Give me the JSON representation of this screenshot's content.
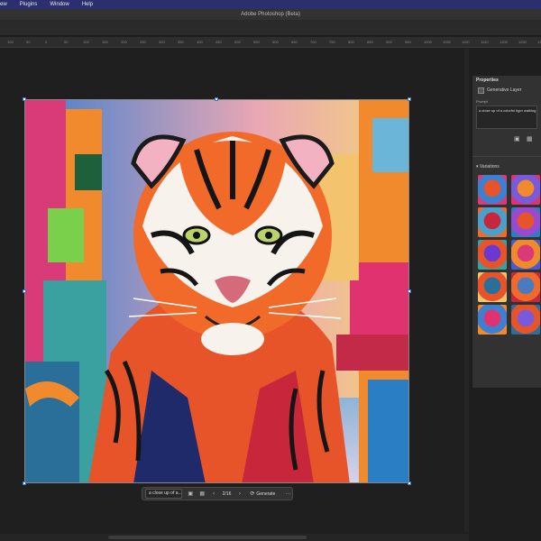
{
  "menu": {
    "items": [
      "ew",
      "Plugins",
      "Window",
      "Help"
    ]
  },
  "window": {
    "title": "Adobe Photoshop (Beta)"
  },
  "ruler": {
    "ticks": [
      "100",
      "50",
      "0",
      "50",
      "100",
      "150",
      "200",
      "250",
      "300",
      "350",
      "400",
      "450",
      "500",
      "550",
      "600",
      "650",
      "700",
      "750",
      "800",
      "850",
      "900",
      "950",
      "1000",
      "1050",
      "1100",
      "1150",
      "1200",
      "1250",
      "1300",
      "1350"
    ]
  },
  "contextual_bar": {
    "prompt_value": "a close up of a...",
    "counter": "2/16",
    "generate_label": "Generate",
    "prev_symbol": "‹",
    "next_symbol": "›",
    "more_symbol": "···"
  },
  "properties": {
    "title": "Properties",
    "layer_name": "Generative Layer",
    "prompt_label": "Prompt",
    "prompt_value": "a close up of a colorful tiger walking",
    "variations_label": "Variations"
  },
  "icons": {
    "image": "image-icon",
    "grid": "grid-icon",
    "generate": "generate-icon",
    "more": "more-icon",
    "collapse": "chevron-down-icon"
  },
  "colors": {
    "menubar": "#2b2f6e",
    "selection": "#3a6fd8"
  }
}
